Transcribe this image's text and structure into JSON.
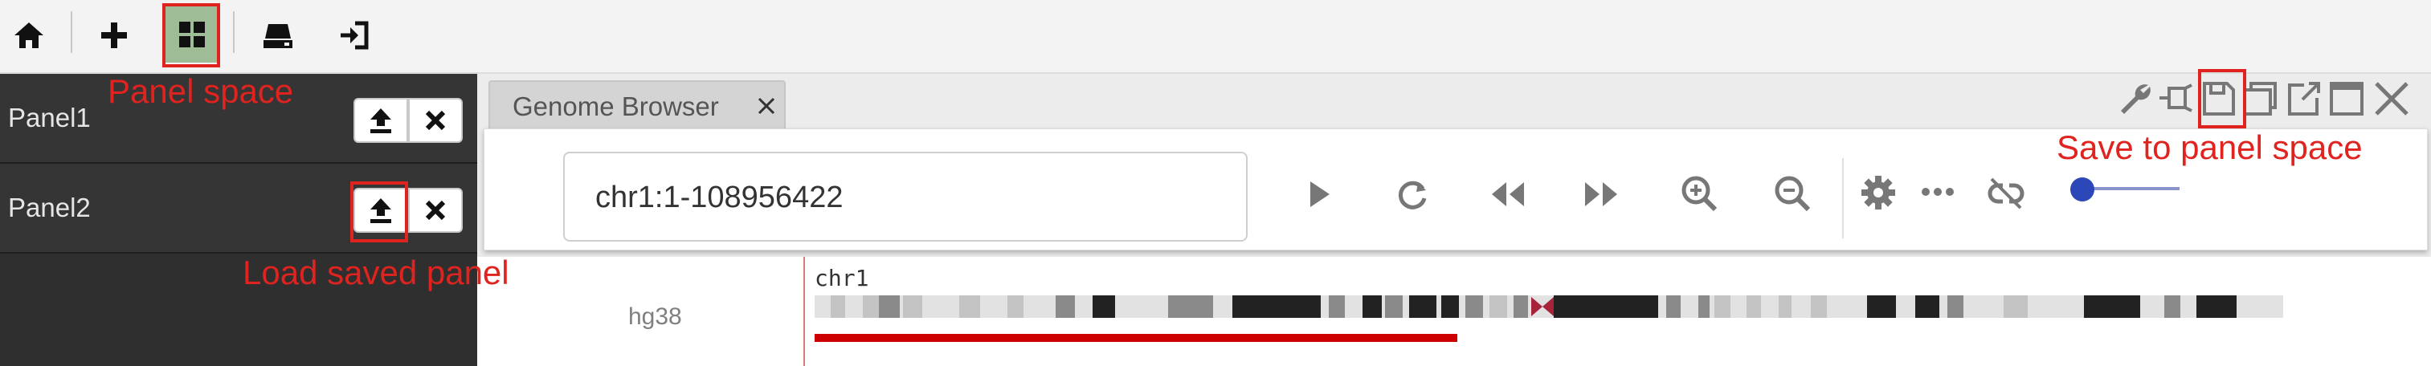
{
  "toolbar": {
    "icons": [
      "home-icon",
      "plus-icon",
      "grid-icon",
      "hard-drive-icon",
      "sign-in-icon"
    ]
  },
  "panels": [
    {
      "name": "Panel1"
    },
    {
      "name": "Panel2"
    }
  ],
  "tab": {
    "label": "Genome Browser"
  },
  "window_icons": [
    "wrench-icon",
    "pin-icon",
    "save-icon",
    "restore-icon",
    "popout-icon",
    "maximize-icon",
    "close-icon"
  ],
  "browser": {
    "locus": "chr1:1-108956422",
    "nav_icons": [
      "play-icon",
      "refresh-icon",
      "rewind-icon",
      "fast-forward-icon",
      "zoom-in-icon",
      "zoom-out-icon",
      "gear-icon",
      "ellipsis-icon",
      "unlink-icon"
    ],
    "zoom_slider_level": 0.1
  },
  "track": {
    "genome": "hg38",
    "chromosome": "chr1"
  },
  "annotations": {
    "panel_space": "Panel space",
    "load_saved": "Load  saved panel",
    "save_to": "Save to panel space"
  },
  "colors": {
    "annotation": "#e0231f",
    "active_toolbar_button": "#9ebd97",
    "viewport_bar": "#cc0000",
    "slider": "#2c47b8"
  }
}
